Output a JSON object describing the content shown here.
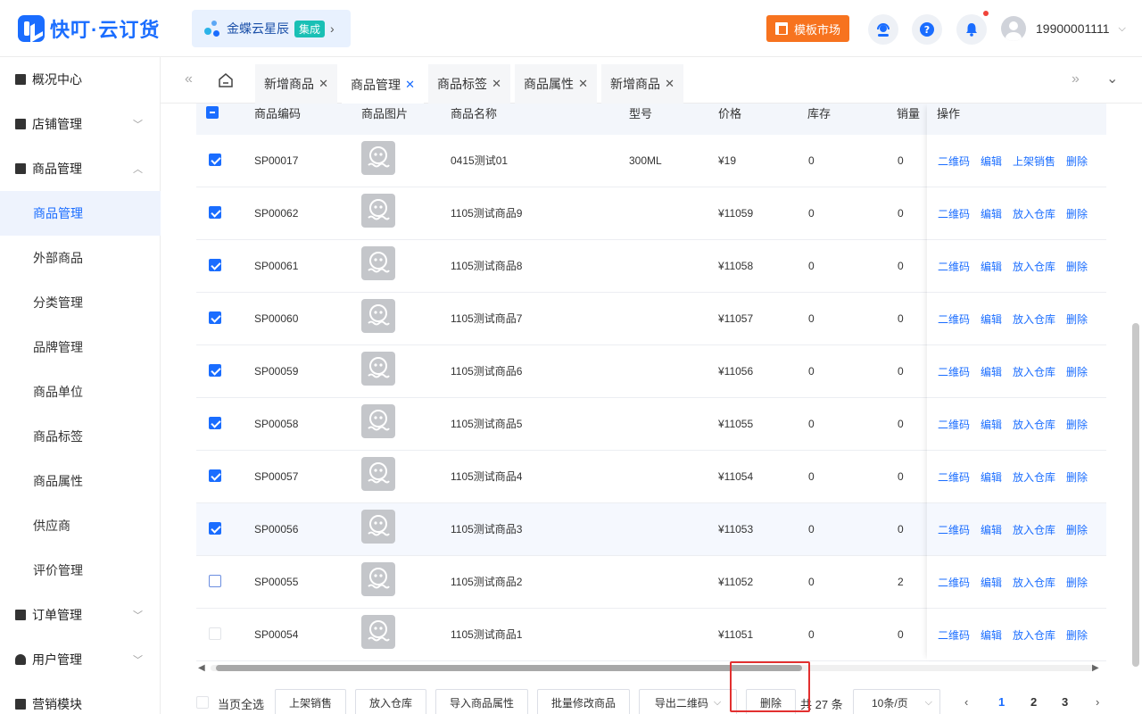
{
  "header": {
    "logo_text": "快叮·云订货",
    "brand_text": "金蝶云星辰",
    "brand_badge": "集成",
    "brand_arrow": "›",
    "market_label": "模板市场",
    "user_name": "19900001111",
    "user_caret": "⌵"
  },
  "sidebar": {
    "groups": {
      "overview": "概况中心",
      "shop": "店铺管理",
      "goods": "商品管理",
      "order": "订单管理",
      "user": "用户管理",
      "marketing": "营销模块"
    },
    "sub_items": [
      "商品管理",
      "外部商品",
      "分类管理",
      "品牌管理",
      "商品单位",
      "商品标签",
      "商品属性",
      "供应商",
      "评价管理"
    ],
    "active": "商品管理"
  },
  "tabs": [
    "新增商品",
    "商品管理",
    "商品标签",
    "商品属性",
    "新增商品"
  ],
  "table": {
    "headers": {
      "code": "商品编码",
      "image": "商品图片",
      "name": "商品名称",
      "model": "型号",
      "price": "价格",
      "stock": "库存",
      "sales": "销量",
      "ops": "操作"
    },
    "rows": [
      {
        "code": "SP00017",
        "name": "0415测试01",
        "model": "300ML",
        "price": "¥19",
        "stock": "0",
        "sales": "0",
        "op3": "上架销售",
        "checked": "on"
      },
      {
        "code": "SP00062",
        "name": "1105测试商品9",
        "model": "",
        "price": "¥11059",
        "stock": "0",
        "sales": "0",
        "op3": "放入仓库",
        "checked": "on"
      },
      {
        "code": "SP00061",
        "name": "1105测试商品8",
        "model": "",
        "price": "¥11058",
        "stock": "0",
        "sales": "0",
        "op3": "放入仓库",
        "checked": "on"
      },
      {
        "code": "SP00060",
        "name": "1105测试商品7",
        "model": "",
        "price": "¥11057",
        "stock": "0",
        "sales": "0",
        "op3": "放入仓库",
        "checked": "on"
      },
      {
        "code": "SP00059",
        "name": "1105测试商品6",
        "model": "",
        "price": "¥11056",
        "stock": "0",
        "sales": "0",
        "op3": "放入仓库",
        "checked": "on"
      },
      {
        "code": "SP00058",
        "name": "1105测试商品5",
        "model": "",
        "price": "¥11055",
        "stock": "0",
        "sales": "0",
        "op3": "放入仓库",
        "checked": "on"
      },
      {
        "code": "SP00057",
        "name": "1105测试商品4",
        "model": "",
        "price": "¥11054",
        "stock": "0",
        "sales": "0",
        "op3": "放入仓库",
        "checked": "on"
      },
      {
        "code": "SP00056",
        "name": "1105测试商品3",
        "model": "",
        "price": "¥11053",
        "stock": "0",
        "sales": "0",
        "op3": "放入仓库",
        "checked": "on"
      },
      {
        "code": "SP00055",
        "name": "1105测试商品2",
        "model": "",
        "price": "¥11052",
        "stock": "0",
        "sales": "2",
        "op3": "放入仓库",
        "checked": "off"
      },
      {
        "code": "SP00054",
        "name": "1105测试商品1",
        "model": "",
        "price": "¥11051",
        "stock": "0",
        "sales": "0",
        "op3": "放入仓库",
        "checked": "dis"
      }
    ],
    "op_qrcode": "二维码",
    "op_edit": "编辑",
    "op_delete": "删除"
  },
  "footer": {
    "select_all": "当页全选",
    "buttons": [
      "上架销售",
      "放入仓库",
      "导入商品属性",
      "批量修改商品",
      "导出二维码",
      "删除"
    ],
    "export_caret": "⌵",
    "total": "共 27 条",
    "page_size": "10条/页",
    "pages": [
      "1",
      "2",
      "3"
    ],
    "current_page": "1"
  },
  "colors": {
    "primary": "#1a6dff",
    "market": "#f7731f",
    "badge": "#19c0b5",
    "highlight_box": "#e23030"
  }
}
